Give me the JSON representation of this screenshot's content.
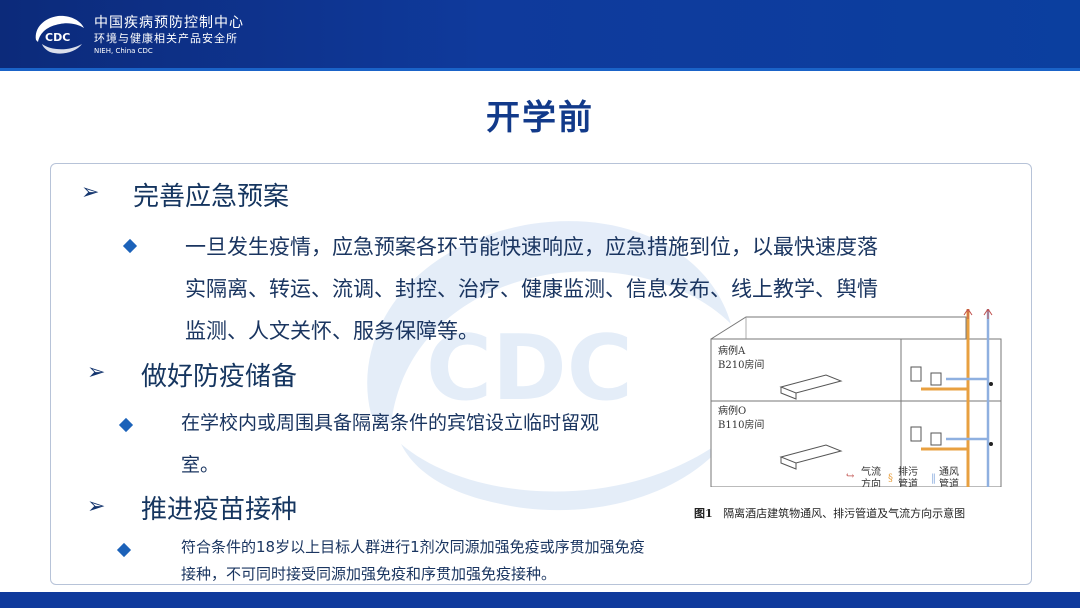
{
  "header": {
    "org_name": "中国疾病预防控制中心",
    "dept_name": "环境与健康相关产品安全所",
    "dept_en": "NIEH, China CDC",
    "logo_text": "CDC"
  },
  "slide": {
    "title": "开学前",
    "sections": [
      {
        "heading": "完善应急预案",
        "body": [
          "一旦发生疫情，应急预案各环节能快速响应，应急措施到位，以最快速度落",
          "实隔离、转运、流调、封控、治疗、健康监测、信息发布、线上教学、舆情",
          "监测、人文关怀、服务保障等。"
        ]
      },
      {
        "heading": "做好防疫储备",
        "body": [
          "在学校内或周围具备隔离条件的宾馆设立临时留观",
          "室。"
        ]
      },
      {
        "heading": "推进疫苗接种",
        "body": [
          "符合条件的18岁以上目标人群进行1剂次同源加强免疫或序贯加强免疫",
          "接种，不可同时接受同源加强免疫和序贯加强免疫接种。"
        ]
      }
    ]
  },
  "watermark": {
    "text": "CDC"
  },
  "figure": {
    "room_a_1": "病例A",
    "room_a_2": "B210房间",
    "room_o_1": "病例O",
    "room_o_2": "B110房间",
    "legend_air_1": "气流",
    "legend_air_2": "方向",
    "legend_drain_1": "排污",
    "legend_drain_2": "管道",
    "legend_vent_1": "通风",
    "legend_vent_2": "管道",
    "caption_num": "图1",
    "caption_text": "隔离酒店建筑物通风、排污管道及气流方向示意图"
  },
  "colors": {
    "header_bg": "#0f3a9c",
    "title": "#123a8a",
    "accent_bullet": "#1c62b9",
    "drain_pipe": "#e8a040",
    "vent_pipe": "#8fb0e0",
    "air_flow": "#c0504d"
  }
}
